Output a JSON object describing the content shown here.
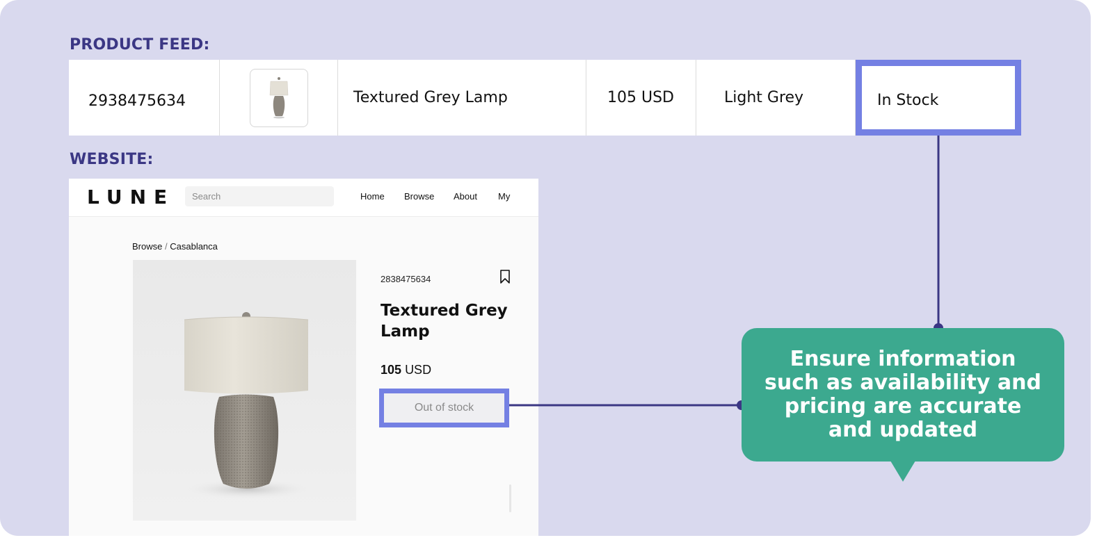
{
  "labels": {
    "product_feed": "PRODUCT FEED:",
    "website": "WEBSITE:"
  },
  "feed": {
    "id": "2938475634",
    "image_icon": "lamp-thumbnail",
    "name": "Textured Grey Lamp",
    "price": "105 USD",
    "color": "Light Grey",
    "stock": "In Stock"
  },
  "site": {
    "logo": "LUNE",
    "search_placeholder": "Search",
    "nav": {
      "home": "Home",
      "browse": "Browse",
      "about": "About",
      "my": "My"
    },
    "breadcrumb": {
      "parent": "Browse",
      "separator": "/",
      "current": "Casablanca"
    },
    "product": {
      "sku": "2838475634",
      "title": "Textured Grey Lamp",
      "price_amount": "105",
      "price_currency": "USD",
      "stock_button": "Out of stock",
      "bookmark_icon": "bookmark-icon"
    }
  },
  "callout": {
    "text": "Ensure information such as availability and pricing are accurate and updated"
  },
  "colors": {
    "background": "#d9d9ee",
    "label": "#3b3784",
    "highlight": "#7480e3",
    "callout": "#3ca98f",
    "connector": "#3b3784"
  }
}
